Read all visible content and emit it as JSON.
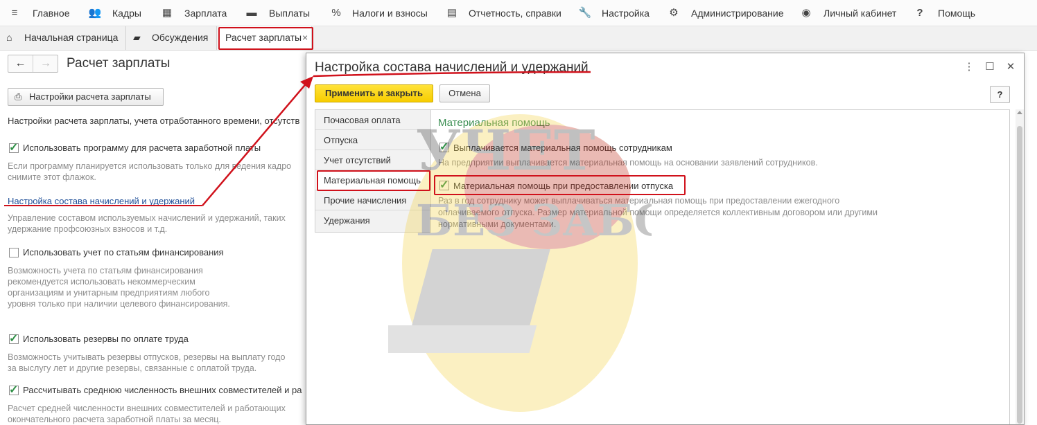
{
  "top_menu": [
    {
      "icon": "hamburger-icon",
      "label": "Главное"
    },
    {
      "icon": "people-icon",
      "label": "Кадры"
    },
    {
      "icon": "calculator-icon",
      "label": "Зарплата"
    },
    {
      "icon": "wallet-icon",
      "label": "Выплаты"
    },
    {
      "icon": "percent-icon",
      "label": "Налоги и взносы"
    },
    {
      "icon": "reports-icon",
      "label": "Отчетность, справки"
    },
    {
      "icon": "wrench-icon",
      "label": "Настройка"
    },
    {
      "icon": "gear-icon",
      "label": "Администрирование"
    },
    {
      "icon": "user-icon",
      "label": "Личный кабинет"
    },
    {
      "icon": "question-icon",
      "label": "Помощь"
    }
  ],
  "tabs": [
    {
      "icon": "home-icon",
      "label": "Начальная страница"
    },
    {
      "icon": "chat-icon",
      "label": "Обсуждения"
    },
    {
      "label": "Расчет зарплаты",
      "close": "×",
      "active": true
    }
  ],
  "left": {
    "nav_back": "←",
    "nav_forward": "→",
    "title": "Расчет зарплаты",
    "settings_button": "Настройки расчета зарплаты",
    "intro": "Настройки расчета зарплаты, учета отработанного времени, отсутств",
    "options": [
      {
        "checked": true,
        "label": "Использовать программу для расчета заработной платы",
        "note": [
          "Если программу планируется использовать только для ведения кадро",
          "снимите этот флажок."
        ]
      },
      {
        "checked": false,
        "label": "Использовать учет по статьям финансирования",
        "note": [
          "Возможность учета по статьям финансирования",
          "рекомендуется использовать некоммерческим",
          "организациям и унитарным предприятиям любого",
          "уровня только при наличии целевого финансирования."
        ]
      },
      {
        "checked": true,
        "label": "Использовать резервы по оплате труда",
        "note": [
          "Возможность учитывать резервы отпусков,  резервы на выплату годо",
          "за выслугу лет и другие резервы, связанные с оплатой труда."
        ]
      },
      {
        "checked": true,
        "label": "Рассчитывать среднюю численность внешних совместителей и ра",
        "note": [
          "Расчет средней численности внешних совместителей и работающих",
          "окончательного расчета заработной платы за месяц."
        ]
      }
    ],
    "link": "Настройка состава начислений и удержаний",
    "link_note": [
      "Управление составом используемых начислений и удержаний, таких",
      "удержание профсоюзных взносов и т.д."
    ]
  },
  "modal": {
    "title": "Настройка состава начислений и удержаний",
    "controls": {
      "more": "⋮",
      "maximize": "☐",
      "close": "✕"
    },
    "apply_button": "Применить и закрыть",
    "cancel_button": "Отмена",
    "help_button": "?",
    "sections": [
      "Почасовая оплата",
      "Отпуска",
      "Учет отсутствий",
      "Материальная помощь",
      "Прочие начисления",
      "Удержания"
    ],
    "selected_section": "Материальная помощь",
    "group_title": "Материальная помощь",
    "options": [
      {
        "checked": true,
        "label": "Выплачивается материальная помощь сотрудникам",
        "note": [
          "На предприятии выплачивается материальная помощь на основании заявлений сотрудников."
        ]
      },
      {
        "checked": true,
        "label": "Материальная помощь при предоставлении отпуска",
        "note": [
          "Раз в год сотруднику может выплачиваться материальная помощь при предоставлении ежегодного",
          "оплачиваемого отпуска. Размер материальной помощи определяется коллективным договором или другими",
          "нормативными документами."
        ]
      }
    ]
  },
  "watermark": {
    "line1": "УЧЕТ",
    "line2": "БЕЗ ЗАБОТ"
  },
  "colors": {
    "accent_green": "#3a9b58",
    "annotation_red": "#d0111b",
    "primary_button": "#f7cd00",
    "link_blue": "#1d4d97"
  }
}
